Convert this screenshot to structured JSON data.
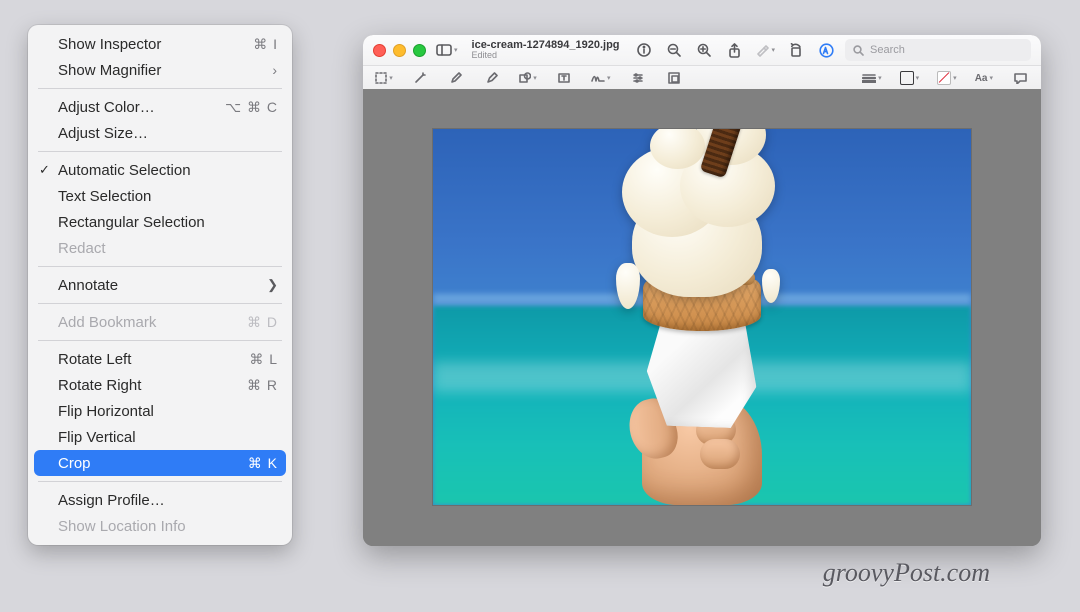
{
  "menu": {
    "groups": [
      [
        {
          "id": "show-inspector",
          "label": "Show Inspector",
          "shortcut": "⌘ I"
        },
        {
          "id": "show-magnifier",
          "label": "Show Magnifier",
          "shortcut": "›"
        }
      ],
      [
        {
          "id": "adjust-color",
          "label": "Adjust Color…",
          "shortcut": "⌥ ⌘ C"
        },
        {
          "id": "adjust-size",
          "label": "Adjust Size…"
        }
      ],
      [
        {
          "id": "automatic-selection",
          "label": "Automatic Selection",
          "checked": true
        },
        {
          "id": "text-selection",
          "label": "Text Selection"
        },
        {
          "id": "rectangular-selection",
          "label": "Rectangular Selection"
        },
        {
          "id": "redact",
          "label": "Redact",
          "disabled": true
        }
      ],
      [
        {
          "id": "annotate",
          "label": "Annotate",
          "submenu": true
        }
      ],
      [
        {
          "id": "add-bookmark",
          "label": "Add Bookmark",
          "shortcut": "⌘ D",
          "disabled": true
        }
      ],
      [
        {
          "id": "rotate-left",
          "label": "Rotate Left",
          "shortcut": "⌘ L"
        },
        {
          "id": "rotate-right",
          "label": "Rotate Right",
          "shortcut": "⌘ R"
        },
        {
          "id": "flip-horizontal",
          "label": "Flip Horizontal"
        },
        {
          "id": "flip-vertical",
          "label": "Flip Vertical"
        },
        {
          "id": "crop",
          "label": "Crop",
          "shortcut": "⌘ K",
          "highlight": true
        }
      ],
      [
        {
          "id": "assign-profile",
          "label": "Assign Profile…"
        },
        {
          "id": "show-location-info",
          "label": "Show Location Info",
          "disabled": true
        }
      ]
    ]
  },
  "window": {
    "filename": "ice-cream-1274894_1920.jpg",
    "edited": "Edited",
    "search_placeholder": "Search"
  },
  "watermark": "groovyPost.com"
}
